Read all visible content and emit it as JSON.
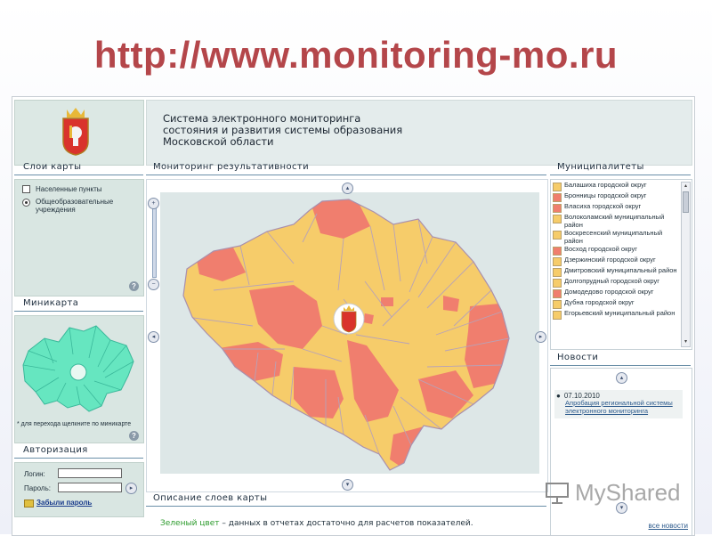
{
  "slide": {
    "title": "http://www.monitoring-mo.ru"
  },
  "header": {
    "lines": [
      "Система электронного мониторинга",
      "состояния и развития системы образования",
      "Московской области"
    ]
  },
  "colors": {
    "yellow": "#f6cc6a",
    "red": "#f07e6e",
    "mint": "#66e6c0",
    "panel": "#d9e6e2",
    "heading_line": "#6a8fa8"
  },
  "layers": {
    "heading": "Слои карты",
    "items": [
      {
        "label": "Населенные пункты",
        "control": "checkbox",
        "checked": false
      },
      {
        "label": "Общеобразовательные учреждения",
        "control": "radio",
        "checked": true
      }
    ]
  },
  "minimap": {
    "heading": "Миникарта",
    "note": "* для перехода щелкните по миникарте"
  },
  "auth": {
    "heading": "Авторизация",
    "login_label": "Логин:",
    "password_label": "Пароль:",
    "login_value": "",
    "password_value": "",
    "forgot_label": "Забыли пароль"
  },
  "monitoring": {
    "heading": "Мониторинг результативности"
  },
  "legend": {
    "heading": "Описание слоев карты",
    "green_term": "Зеленый цвет",
    "green_text": " – данных в отчетах достаточно для расчетов показателей."
  },
  "municipalities": {
    "heading": "Муниципалитеты",
    "items": [
      {
        "name": "Балашиха городской округ",
        "color": "yellow"
      },
      {
        "name": "Бронницы городской округ",
        "color": "red"
      },
      {
        "name": "Власиха городской округ",
        "color": "red"
      },
      {
        "name": "Волоколамский муниципальный район",
        "color": "yellow"
      },
      {
        "name": "Воскресенский муниципальный район",
        "color": "yellow"
      },
      {
        "name": "Восход городской округ",
        "color": "red"
      },
      {
        "name": "Дзержинский городской округ",
        "color": "yellow"
      },
      {
        "name": "Дмитровский муниципальный район",
        "color": "yellow"
      },
      {
        "name": "Долгопрудный городской округ",
        "color": "yellow"
      },
      {
        "name": "Домодедово городской округ",
        "color": "red"
      },
      {
        "name": "Дубна городской округ",
        "color": "yellow"
      },
      {
        "name": "Егорьевский муниципальный район",
        "color": "yellow"
      }
    ]
  },
  "news": {
    "heading": "Новости",
    "items": [
      {
        "date": "07.10.2010",
        "text": "Апробация региональной системы электронного мониторинга"
      }
    ],
    "all_label": "все новости"
  },
  "watermark": {
    "text": "MyShared"
  }
}
